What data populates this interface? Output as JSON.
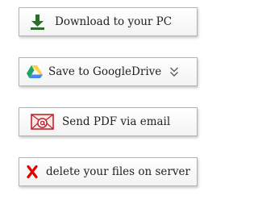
{
  "buttons": {
    "download": {
      "label": "Download to your PC",
      "icon": "download-icon"
    },
    "google_drive": {
      "label": "Save to GoogleDrive",
      "icon": "google-drive-icon",
      "chevron_icon": "double-chevron-down-icon"
    },
    "email": {
      "label": "Send PDF via email",
      "icon": "email-icon"
    },
    "delete": {
      "label": "delete your files on server",
      "icon": "red-x-icon"
    }
  },
  "colors": {
    "download_green": "#2e6b2e",
    "email_red": "#c0272d",
    "delete_red": "#e00000",
    "drive_green": "#1fa463",
    "drive_yellow": "#ffd04b",
    "drive_blue": "#4687f4"
  }
}
